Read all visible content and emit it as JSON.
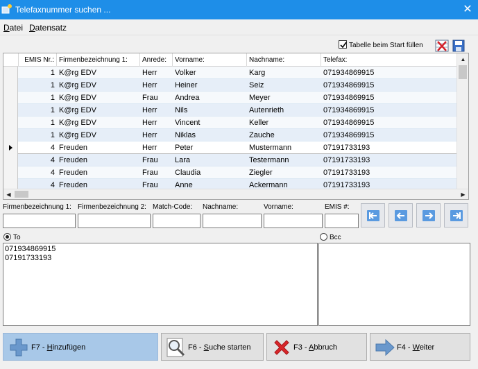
{
  "window": {
    "title": "Telefaxnummer suchen ..."
  },
  "menu": [
    {
      "label": "Datei"
    },
    {
      "label": "Datensatz"
    }
  ],
  "toolbar": {
    "fill_on_start_label": "Tabelle beim Start füllen",
    "fill_on_start_checked": true
  },
  "table": {
    "columns": [
      "EMIS Nr.:",
      "Firmenbezeichnung 1:",
      "Anrede:",
      "Vorname:",
      "Nachname:",
      "Telefax:"
    ],
    "rows": [
      {
        "emis": "1",
        "firma": "K@rg EDV",
        "anrede": "Herr",
        "vorname": "Volker",
        "nachname": "Karg",
        "telefax": "071934869915"
      },
      {
        "emis": "1",
        "firma": "K@rg EDV",
        "anrede": "Herr",
        "vorname": "Heiner",
        "nachname": "Seiz",
        "telefax": "071934869915"
      },
      {
        "emis": "1",
        "firma": "K@rg EDV",
        "anrede": "Frau",
        "vorname": "Andrea",
        "nachname": "Meyer",
        "telefax": "071934869915"
      },
      {
        "emis": "1",
        "firma": "K@rg EDV",
        "anrede": "Herr",
        "vorname": "Nils",
        "nachname": "Autenrieth",
        "telefax": "071934869915"
      },
      {
        "emis": "1",
        "firma": "K@rg EDV",
        "anrede": "Herr",
        "vorname": "Vincent",
        "nachname": "Keller",
        "telefax": "071934869915"
      },
      {
        "emis": "1",
        "firma": "K@rg EDV",
        "anrede": "Herr",
        "vorname": "Niklas",
        "nachname": "Zauche",
        "telefax": "071934869915"
      },
      {
        "emis": "4",
        "firma": "Freuden",
        "anrede": "Herr",
        "vorname": "Peter",
        "nachname": "Mustermann",
        "telefax": "07191733193"
      },
      {
        "emis": "4",
        "firma": "Freuden",
        "anrede": "Frau",
        "vorname": "Lara",
        "nachname": "Testermann",
        "telefax": "07191733193"
      },
      {
        "emis": "4",
        "firma": "Freuden",
        "anrede": "Frau",
        "vorname": "Claudia",
        "nachname": "Ziegler",
        "telefax": "07191733193"
      },
      {
        "emis": "4",
        "firma": "Freuden",
        "anrede": "Frau",
        "vorname": "Anne",
        "nachname": "Ackermann",
        "telefax": "07191733193"
      }
    ],
    "selected_row": 6
  },
  "filters": {
    "firma1_label": "Firmenbezeichnung 1:",
    "firma2_label": "Firmenbezeichnung 2:",
    "matchcode_label": "Match-Code:",
    "nachname_label": "Nachname:",
    "vorname_label": "Vorname:",
    "emis_label": "EMIS #:",
    "firma1_value": "",
    "firma2_value": "",
    "matchcode_value": "",
    "nachname_value": "",
    "vorname_value": "",
    "emis_value": ""
  },
  "recipients": {
    "to_label": "To",
    "bcc_label": "Bcc",
    "to_selected": true,
    "to_lines": [
      "071934869915",
      "07191733193"
    ],
    "bcc_lines": []
  },
  "buttons": {
    "add": "F7 - Hinzufügen",
    "search": "F6 - Suche starten",
    "cancel": "F3 - Abbruch",
    "next": "F4 - Weiter"
  },
  "colors": {
    "titlebar": "#1e8ee8",
    "row_even": "#e6eef8",
    "add_button": "#a8c8e8"
  }
}
